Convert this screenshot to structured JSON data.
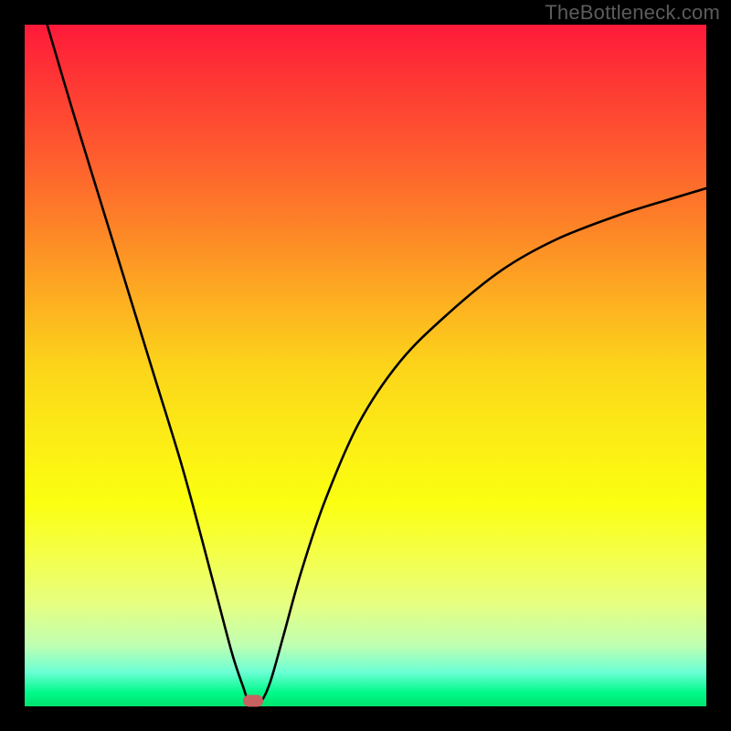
{
  "watermark": "TheBottleneck.com",
  "chart_data": {
    "type": "line",
    "title": "",
    "xlabel": "",
    "ylabel": "",
    "xlim": [
      0,
      1
    ],
    "ylim": [
      0,
      1
    ],
    "series": [
      {
        "name": "bottleneck-curve",
        "x": [
          0.033,
          0.07,
          0.11,
          0.15,
          0.19,
          0.23,
          0.26,
          0.285,
          0.305,
          0.32,
          0.33,
          0.345,
          0.36,
          0.38,
          0.405,
          0.44,
          0.49,
          0.55,
          0.62,
          0.7,
          0.78,
          0.87,
          0.95,
          1.0
        ],
        "y": [
          1.0,
          0.875,
          0.745,
          0.615,
          0.485,
          0.355,
          0.245,
          0.15,
          0.075,
          0.03,
          0.005,
          0.005,
          0.035,
          0.105,
          0.195,
          0.3,
          0.415,
          0.505,
          0.575,
          0.64,
          0.685,
          0.72,
          0.745,
          0.76
        ]
      }
    ],
    "annotations": [
      {
        "name": "optimum-marker",
        "x": 0.335,
        "y": 0.0,
        "color": "#c86260"
      }
    ],
    "background_gradient": {
      "top": "#fe1a3a",
      "middle": "#fcd41a",
      "bottom": "#00e46e"
    }
  }
}
